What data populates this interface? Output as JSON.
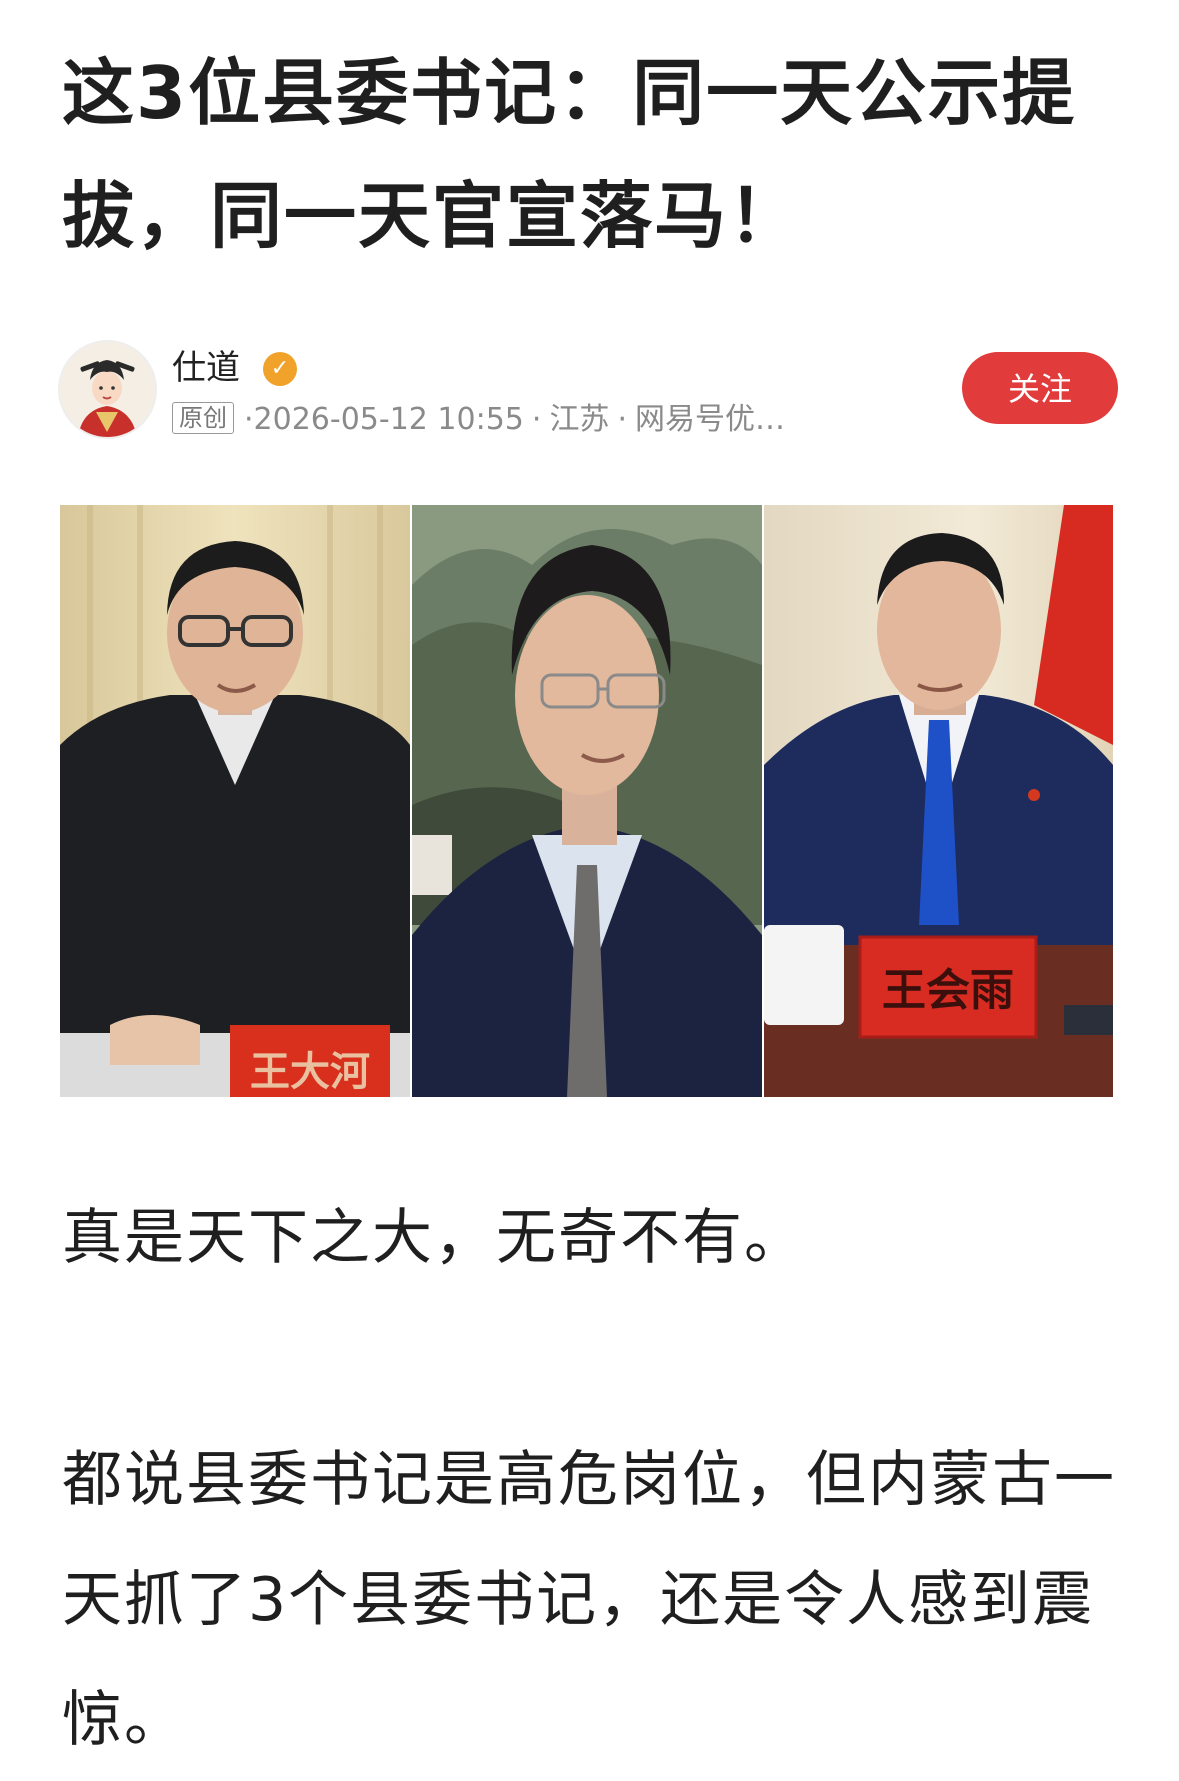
{
  "article": {
    "title": "这3位县委书记：同一天公示提拔，同一天官宣落马！"
  },
  "author": {
    "name": "仕道",
    "verified_icon": "verified-check-icon",
    "original_badge": "原创",
    "meta_prefix": "·",
    "datetime": "2026-05-12 10:55",
    "location": "江苏",
    "source": "网易号优…",
    "follow_label": "关注",
    "follow_color": "#e23b3b"
  },
  "photo": {
    "nameplate_left": "王大河",
    "nameplate_right": "王会雨"
  },
  "body": {
    "paragraphs": [
      "真是天下之大，无奇不有。",
      "都说县委书记是高危岗位，但内蒙古一天抓了3个县委书记，还是令人感到震惊。"
    ]
  }
}
